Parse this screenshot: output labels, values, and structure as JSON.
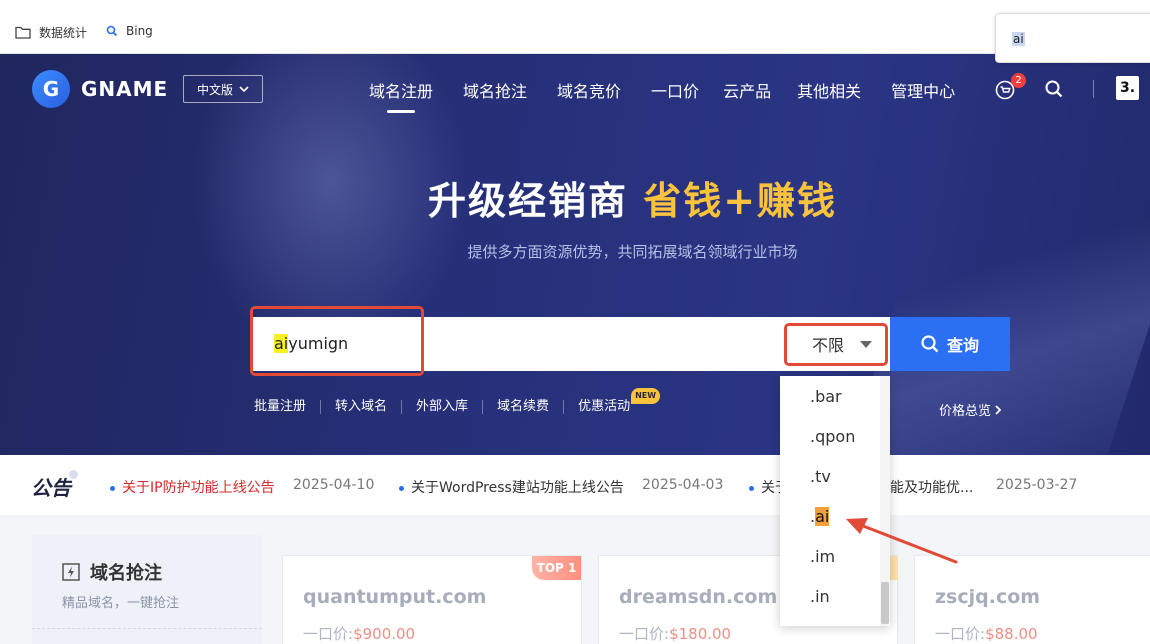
{
  "bookmarks": {
    "items": [
      {
        "label": "数据统计",
        "icon": "folder-icon"
      },
      {
        "label": "Bing",
        "icon": "search-icon"
      }
    ],
    "find_text": "ai"
  },
  "header": {
    "logo_text": "GNAME",
    "language": "中文版",
    "nav": [
      "域名注册",
      "域名抢注",
      "域名竞价",
      "一口价",
      "云产品",
      "其他相关",
      "管理中心"
    ],
    "active_nav": "域名注册",
    "cart_count": "2",
    "user_label": "3."
  },
  "hero": {
    "headline_main": "升级经销商 ",
    "headline_highlight": "省钱+赚钱",
    "subtitle": "提供多方面资源优势，共同拓展域名领域行业市场"
  },
  "search": {
    "query_highlight": "ai",
    "query_rest": "yumign",
    "tld_selected": "不限",
    "button_label": "查询"
  },
  "quick_links": [
    "批量注册",
    "转入域名",
    "外部入库",
    "域名续费",
    "优惠活动"
  ],
  "new_badge": "NEW",
  "price_overview": "价格总览",
  "tld_dropdown": [
    ".bar",
    ".qpon",
    ".tv",
    ".ai",
    ".im",
    ".in"
  ],
  "notice": {
    "title": "公告",
    "items": [
      {
        "text": "关于IP防护功能上线公告",
        "date": "2025-04-10"
      },
      {
        "text": "关于WordPress建站功能上线公告",
        "date": "2025-04-03"
      },
      {
        "text": "关于",
        "text_tail": "能及功能优...",
        "date": "2025-03-27"
      }
    ]
  },
  "snap": {
    "title": "域名抢注",
    "subtitle": "精品域名，一键抢注"
  },
  "domain_cards": [
    {
      "name": "quantumput.com",
      "price_label": "一口价:",
      "price": "$900.00",
      "badge": "TOP 1"
    },
    {
      "name": "dreamsdn.com",
      "price_label": "一口价:",
      "price": "$180.00"
    },
    {
      "name": "zscjq.com",
      "price_label": "一口价:",
      "price": "$88.00"
    }
  ],
  "colors": {
    "accent": "#2b6ff2",
    "highlight": "#fbc23c",
    "annotation_red": "#e04a37"
  }
}
